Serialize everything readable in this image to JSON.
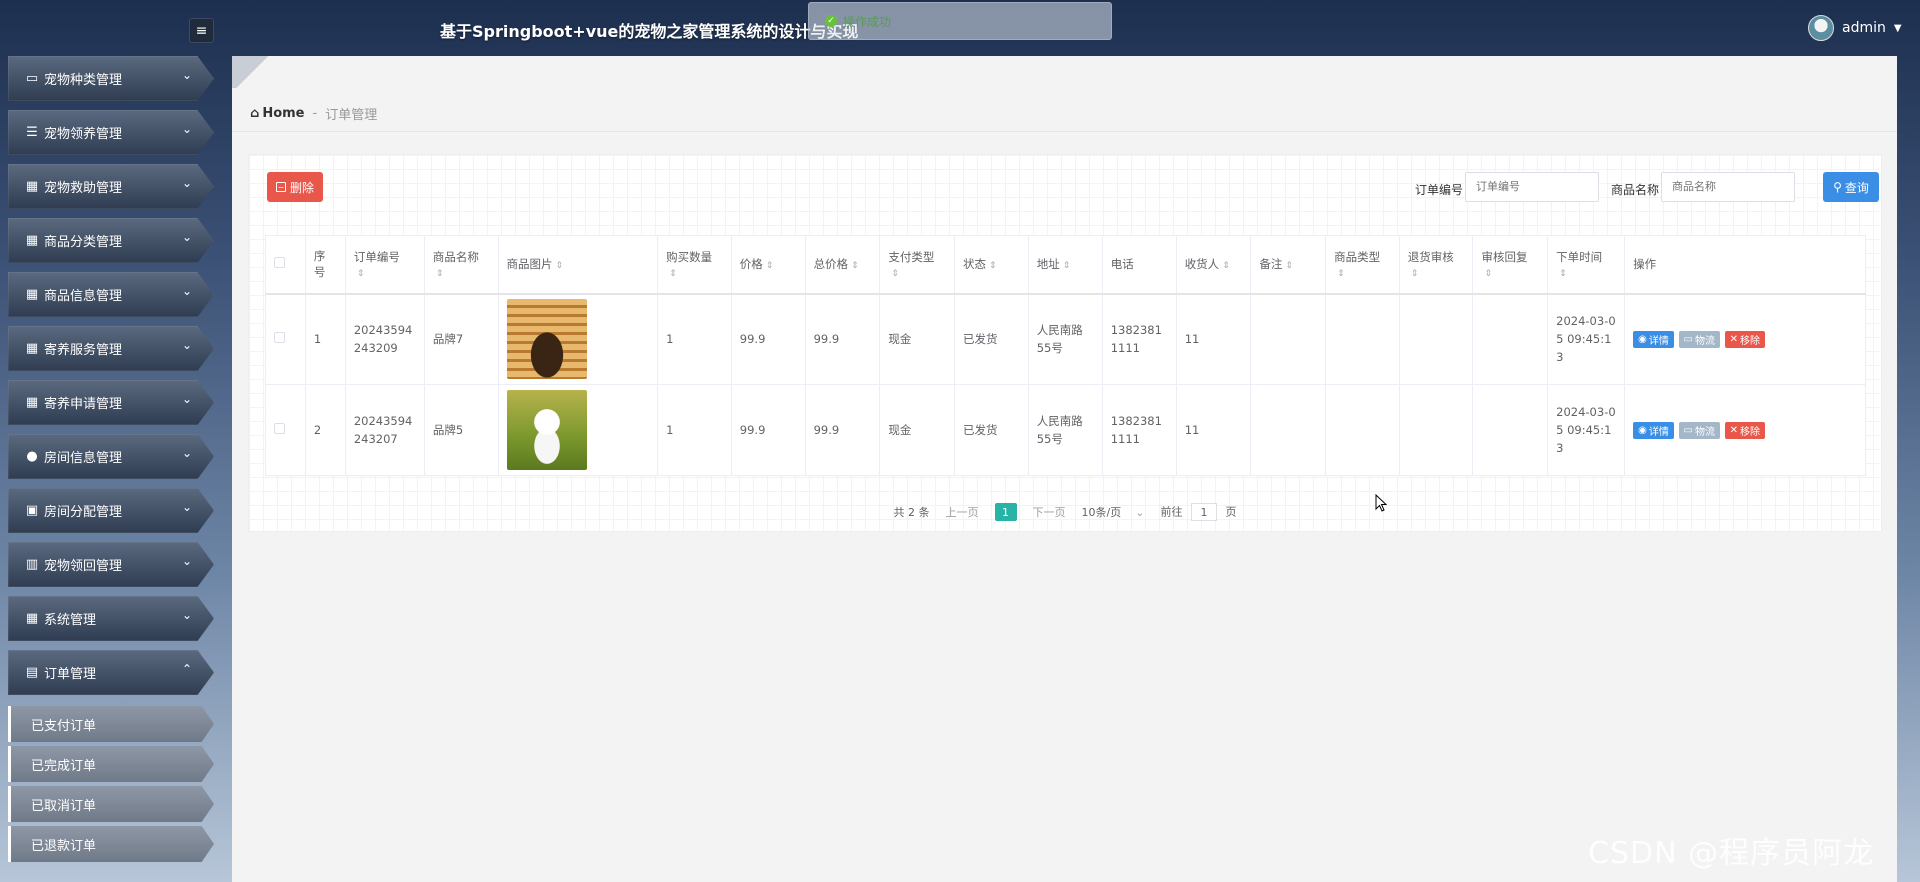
{
  "app": {
    "title": "基于Springboot+vue的宠物之家管理系统的设计与实现",
    "toast": "操作成功",
    "user": "admin"
  },
  "sidebar": {
    "items": [
      {
        "label": "宠物种类管理",
        "icon": "monitor-icon"
      },
      {
        "label": "宠物领养管理",
        "icon": "list-icon"
      },
      {
        "label": "宠物救助管理",
        "icon": "grid-icon"
      },
      {
        "label": "商品分类管理",
        "icon": "grid-icon"
      },
      {
        "label": "商品信息管理",
        "icon": "grid-icon"
      },
      {
        "label": "寄养服务管理",
        "icon": "grid-icon"
      },
      {
        "label": "寄养申请管理",
        "icon": "grid-icon"
      },
      {
        "label": "房间信息管理",
        "icon": "user-icon"
      },
      {
        "label": "房间分配管理",
        "icon": "clipboard-check-icon"
      },
      {
        "label": "宠物领回管理",
        "icon": "bar-chart-icon"
      },
      {
        "label": "系统管理",
        "icon": "grid-icon"
      },
      {
        "label": "订单管理",
        "icon": "clipboard-icon",
        "expanded": true
      }
    ],
    "subitems": [
      "已支付订单",
      "已完成订单",
      "已取消订单",
      "已退款订单"
    ]
  },
  "breadcrumb": {
    "home": "Home",
    "sep": "-",
    "current": "订单管理"
  },
  "toolbar": {
    "delete_label": "删除",
    "order_no_label": "订单编号",
    "order_no_placeholder": "订单编号",
    "product_name_label": "商品名称",
    "product_name_placeholder": "商品名称",
    "search_label": "查询"
  },
  "table": {
    "columns": [
      "序号",
      "订单编号",
      "商品名称",
      "商品图片",
      "购买数量",
      "价格",
      "总价格",
      "支付类型",
      "状态",
      "地址",
      "电话",
      "收货人",
      "备注",
      "商品类型",
      "退货审核",
      "审核回复",
      "下单时间",
      "操作"
    ],
    "rows": [
      {
        "index": "1",
        "order_no": "20243594243209",
        "product": "品牌7",
        "image": "pet-house-image",
        "qty": "1",
        "price": "99.9",
        "total": "99.9",
        "pay_type": "现金",
        "status": "已发货",
        "address": "人民南路55号",
        "phone": "13823811111",
        "receiver": "11",
        "note": "",
        "product_type": "",
        "return_review": "",
        "review_reply": "",
        "time": "2024-03-05 09:45:13"
      },
      {
        "index": "2",
        "order_no": "20243594243207",
        "product": "品牌5",
        "image": "white-dog-image",
        "qty": "1",
        "price": "99.9",
        "total": "99.9",
        "pay_type": "现金",
        "status": "已发货",
        "address": "人民南路55号",
        "phone": "13823811111",
        "receiver": "11",
        "note": "",
        "product_type": "",
        "return_review": "",
        "review_reply": "",
        "time": "2024-03-05 09:45:13"
      }
    ],
    "actions": {
      "detail": "详情",
      "logistics": "物流",
      "remove": "移除"
    }
  },
  "pager": {
    "total": "共 2 条",
    "prev": "上一页",
    "page": "1",
    "next": "下一页",
    "page_size": "10条/页",
    "goto_label": "前往",
    "goto_value": "1",
    "goto_unit": "页"
  },
  "watermark": "CSDN @程序员阿龙",
  "colors": {
    "danger": "#e9574a",
    "primary": "#3a8ee6",
    "active_page": "#27b3a6"
  }
}
